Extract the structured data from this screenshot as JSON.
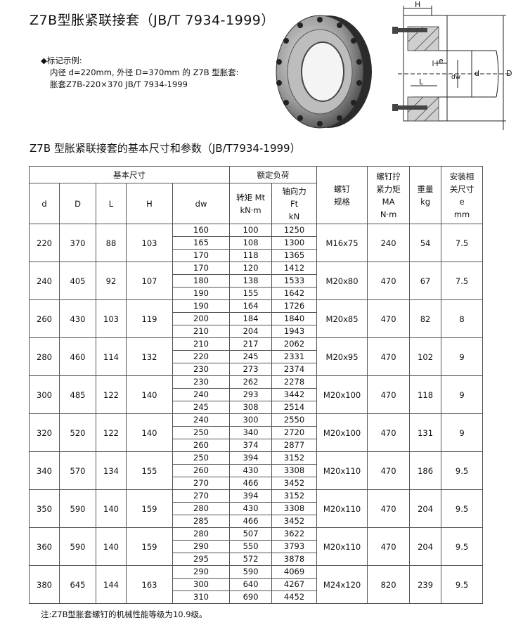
{
  "title": "Z7B型胀紧联接套（JB/T 7934-1999）",
  "example": {
    "lead": "◆标记示例:",
    "line1": "内径 d=220mm, 外径 D=370mm 的 Z7B 型胀套:",
    "line2": "胀套Z7B-220×370    JB/T  7934-1999"
  },
  "drawing_labels": {
    "H": "H",
    "e": "e",
    "dw": "dw",
    "L": "L",
    "d": "d",
    "D": "D"
  },
  "subtitle": "Z7B 型胀紧联接套的基本尺寸和参数（JB/T7934-1999）",
  "table": {
    "groups": {
      "basic": "基本尺寸",
      "load": "额定负荷",
      "bolt": "螺钉\n规格",
      "torque": "螺钉拧\n紧力矩\nMA\nN·m",
      "weight": "重量\nkg",
      "install": "安装相\n关尺寸\ne\nmm"
    },
    "headers": {
      "d": "d",
      "D": "D",
      "L": "L",
      "H": "H",
      "dw": "dw",
      "mt": "转矩 Mt\nkN·m",
      "ft": "轴向力\nFt\nkN"
    },
    "rows": [
      {
        "d": "220",
        "D": "370",
        "L": "88",
        "H": "103",
        "bolt": "M16x75",
        "ma": "240",
        "kg": "54",
        "e": "7.5",
        "sub": [
          [
            "160",
            "100",
            "1250"
          ],
          [
            "165",
            "108",
            "1300"
          ],
          [
            "170",
            "118",
            "1365"
          ]
        ]
      },
      {
        "d": "240",
        "D": "405",
        "L": "92",
        "H": "107",
        "bolt": "M20x80",
        "ma": "470",
        "kg": "67",
        "e": "7.5",
        "sub": [
          [
            "170",
            "120",
            "1412"
          ],
          [
            "180",
            "138",
            "1533"
          ],
          [
            "190",
            "155",
            "1642"
          ]
        ]
      },
      {
        "d": "260",
        "D": "430",
        "L": "103",
        "H": "119",
        "bolt": "M20x85",
        "ma": "470",
        "kg": "82",
        "e": "8",
        "sub": [
          [
            "190",
            "164",
            "1726"
          ],
          [
            "200",
            "184",
            "1840"
          ],
          [
            "210",
            "204",
            "1943"
          ]
        ]
      },
      {
        "d": "280",
        "D": "460",
        "L": "114",
        "H": "132",
        "bolt": "M20x95",
        "ma": "470",
        "kg": "102",
        "e": "9",
        "sub": [
          [
            "210",
            "217",
            "2062"
          ],
          [
            "220",
            "245",
            "2331"
          ],
          [
            "230",
            "273",
            "2374"
          ]
        ]
      },
      {
        "d": "300",
        "D": "485",
        "L": "122",
        "H": "140",
        "bolt": "M20x100",
        "ma": "470",
        "kg": "118",
        "e": "9",
        "sub": [
          [
            "230",
            "262",
            "2278"
          ],
          [
            "240",
            "293",
            "3442"
          ],
          [
            "245",
            "308",
            "2514"
          ]
        ]
      },
      {
        "d": "320",
        "D": "520",
        "L": "122",
        "H": "140",
        "bolt": "M20x100",
        "ma": "470",
        "kg": "131",
        "e": "9",
        "sub": [
          [
            "240",
            "300",
            "2550"
          ],
          [
            "250",
            "340",
            "2720"
          ],
          [
            "260",
            "374",
            "2877"
          ]
        ]
      },
      {
        "d": "340",
        "D": "570",
        "L": "134",
        "H": "155",
        "bolt": "M20x110",
        "ma": "470",
        "kg": "186",
        "e": "9.5",
        "sub": [
          [
            "250",
            "394",
            "3152"
          ],
          [
            "260",
            "430",
            "3308"
          ],
          [
            "270",
            "466",
            "3452"
          ]
        ]
      },
      {
        "d": "350",
        "D": "590",
        "L": "140",
        "H": "159",
        "bolt": "M20x110",
        "ma": "470",
        "kg": "204",
        "e": "9.5",
        "sub": [
          [
            "270",
            "394",
            "3152"
          ],
          [
            "280",
            "430",
            "3308"
          ],
          [
            "285",
            "466",
            "3452"
          ]
        ]
      },
      {
        "d": "360",
        "D": "590",
        "L": "140",
        "H": "159",
        "bolt": "M20x110",
        "ma": "470",
        "kg": "204",
        "e": "9.5",
        "sub": [
          [
            "280",
            "507",
            "3622"
          ],
          [
            "290",
            "550",
            "3793"
          ],
          [
            "295",
            "572",
            "3878"
          ]
        ]
      },
      {
        "d": "380",
        "D": "645",
        "L": "144",
        "H": "163",
        "bolt": "M24x120",
        "ma": "820",
        "kg": "239",
        "e": "9.5",
        "sub": [
          [
            "290",
            "590",
            "4069"
          ],
          [
            "300",
            "640",
            "4267"
          ],
          [
            "310",
            "690",
            "4452"
          ]
        ]
      }
    ]
  },
  "note": "注:Z7B型胀套螺钉的机械性能等级为10.9级。"
}
